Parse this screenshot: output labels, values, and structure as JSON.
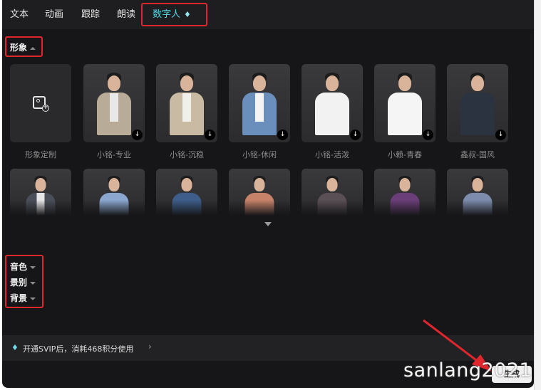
{
  "tabs": [
    {
      "label": "文本"
    },
    {
      "label": "动画"
    },
    {
      "label": "跟踪"
    },
    {
      "label": "朗读"
    },
    {
      "label": "数字人",
      "icon": "diamond-icon",
      "active": true
    }
  ],
  "sections": {
    "appearance": {
      "label": "形象",
      "expanded": true
    },
    "voice": {
      "label": "音色"
    },
    "scene": {
      "label": "景别"
    },
    "background": {
      "label": "背景"
    }
  },
  "avatars_row1": [
    {
      "label": "形象定制",
      "type": "custom",
      "icon": "add-image-icon"
    },
    {
      "label": "小铭-专业",
      "suit": "#b8ab98",
      "shirt": "#e8e8e8",
      "bg": "#4a4a4c",
      "download": true
    },
    {
      "label": "小铭-沉稳",
      "suit": "#c9baa3",
      "shirt": "#f0efe9",
      "bg": "#4a4a4c",
      "download": true
    },
    {
      "label": "小铭-休闲",
      "suit": "#6a8fbd",
      "shirt": "#f4f4f4",
      "bg": "#4a4a4c",
      "download": true
    },
    {
      "label": "小铭-活泼",
      "suit": "#f2f2f2",
      "shirt": "#f2f2f2",
      "bg": "#4a4a4c",
      "download": true
    },
    {
      "label": "小赖-青春",
      "suit": "#f5f5f5",
      "shirt": "#f5f5f5",
      "bg": "#4a4a4c",
      "download": true
    },
    {
      "label": "鑫叔-国风",
      "suit": "#2c3340",
      "shirt": "#2c3340",
      "bg": "#4a4a4c",
      "download": true
    }
  ],
  "avatars_row2": [
    {
      "suit": "#4b4f59",
      "shirt": "#e6e6e6"
    },
    {
      "suit": "#8ba7cf",
      "shirt": "#8ba7cf"
    },
    {
      "suit": "#3e5d8a",
      "shirt": "#3e5d8a"
    },
    {
      "suit": "#c7836a",
      "shirt": "#c7836a"
    },
    {
      "suit": "#5a4f55",
      "shirt": "#5a4f55"
    },
    {
      "suit": "#6a3e78",
      "shirt": "#6a3e78"
    },
    {
      "suit": "#7d8cad",
      "shirt": "#7d8cad"
    }
  ],
  "promo": {
    "icon": "diamond-icon",
    "text": "开通SVIP后，消耗468积分使用",
    "chevron": "›"
  },
  "generate_button": {
    "label": "生成"
  },
  "watermark": "sanlang2021",
  "colors": {
    "accent": "#4fd7e6",
    "annotation_red": "#e0262d",
    "panel_bg": "#161618"
  }
}
